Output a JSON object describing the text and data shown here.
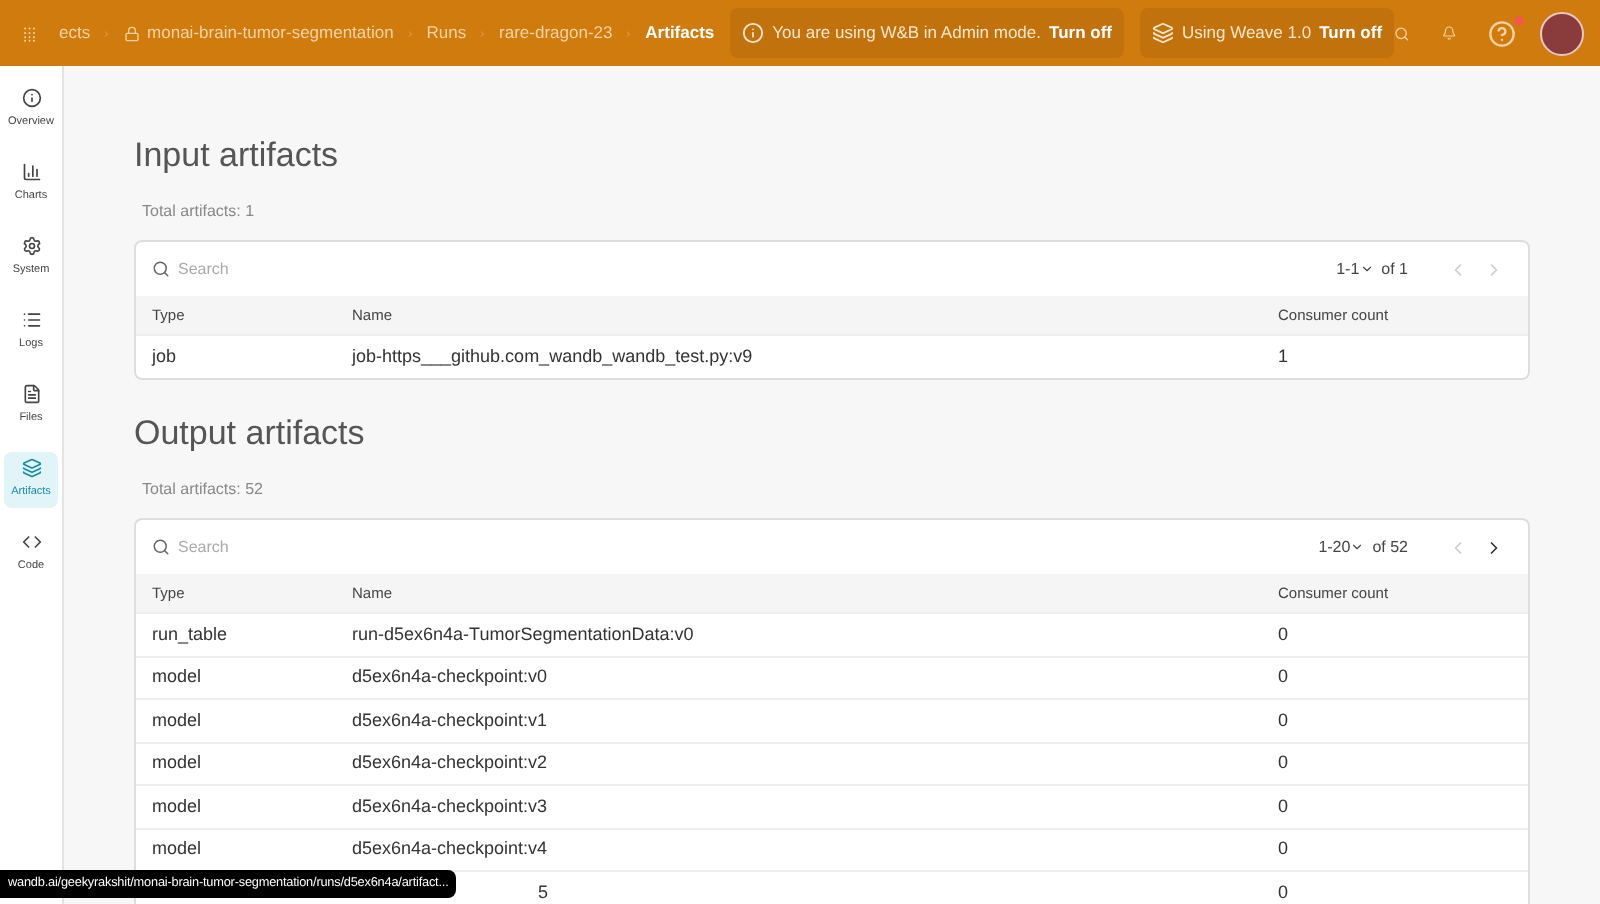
{
  "breadcrumbs": [
    {
      "label": "ects",
      "locked": false,
      "current": false
    },
    {
      "label": "monai-brain-tumor-segmentation",
      "locked": true,
      "current": false
    },
    {
      "label": "Runs",
      "locked": false,
      "current": false
    },
    {
      "label": "rare-dragon-23",
      "locked": false,
      "current": false
    },
    {
      "label": "Artifacts",
      "locked": false,
      "current": true
    }
  ],
  "banners": [
    {
      "kind": "info",
      "text": "You are using W&B in Admin mode.",
      "action": "Turn off"
    },
    {
      "kind": "layers",
      "text": "Using Weave 1.0",
      "action": "Turn off"
    }
  ],
  "help_badge": true,
  "sidebar": {
    "items": [
      {
        "kind": "info",
        "label": "Overview",
        "selected": false
      },
      {
        "kind": "chart",
        "label": "Charts",
        "selected": false
      },
      {
        "kind": "gear",
        "label": "System",
        "selected": false
      },
      {
        "kind": "list",
        "label": "Logs",
        "selected": false
      },
      {
        "kind": "file",
        "label": "Files",
        "selected": false
      },
      {
        "kind": "layers",
        "label": "Artifacts",
        "selected": true
      },
      {
        "kind": "code",
        "label": "Code",
        "selected": false
      }
    ]
  },
  "sections": [
    {
      "title": "Input artifacts",
      "total": "Total artifacts: 1",
      "search": {
        "placeholder": "Search"
      },
      "pagination": {
        "range": "1-1",
        "of": "of 1",
        "prev_enabled": false,
        "next_enabled": false
      },
      "columns": [
        "Type",
        "Name",
        "Consumer count"
      ],
      "rows": [
        {
          "type": "job",
          "name": "job-https___github.com_wandb_wandb_test.py:v9",
          "count": "1"
        }
      ]
    },
    {
      "title": "Output artifacts",
      "total": "Total artifacts: 52",
      "search": {
        "placeholder": "Search"
      },
      "pagination": {
        "range": "1-20",
        "of": "of 52",
        "prev_enabled": false,
        "next_enabled": true
      },
      "columns": [
        "Type",
        "Name",
        "Consumer count"
      ],
      "rows": [
        {
          "type": "run_table",
          "name": "run-d5ex6n4a-TumorSegmentationData:v0",
          "count": "0"
        },
        {
          "type": "model",
          "name": "d5ex6n4a-checkpoint:v0",
          "count": "0"
        },
        {
          "type": "model",
          "name": "d5ex6n4a-checkpoint:v1",
          "count": "0"
        },
        {
          "type": "model",
          "name": "d5ex6n4a-checkpoint:v2",
          "count": "0"
        },
        {
          "type": "model",
          "name": "d5ex6n4a-checkpoint:v3",
          "count": "0"
        },
        {
          "type": "model",
          "name": "d5ex6n4a-checkpoint:v4",
          "count": "0"
        },
        {
          "kind": "covered",
          "name": "5",
          "count": "0"
        }
      ]
    }
  ],
  "status_url": "wandb.ai/geekyrakshit/monai-brain-tumor-segmentation/runs/d5ex6n4a/artifact..."
}
